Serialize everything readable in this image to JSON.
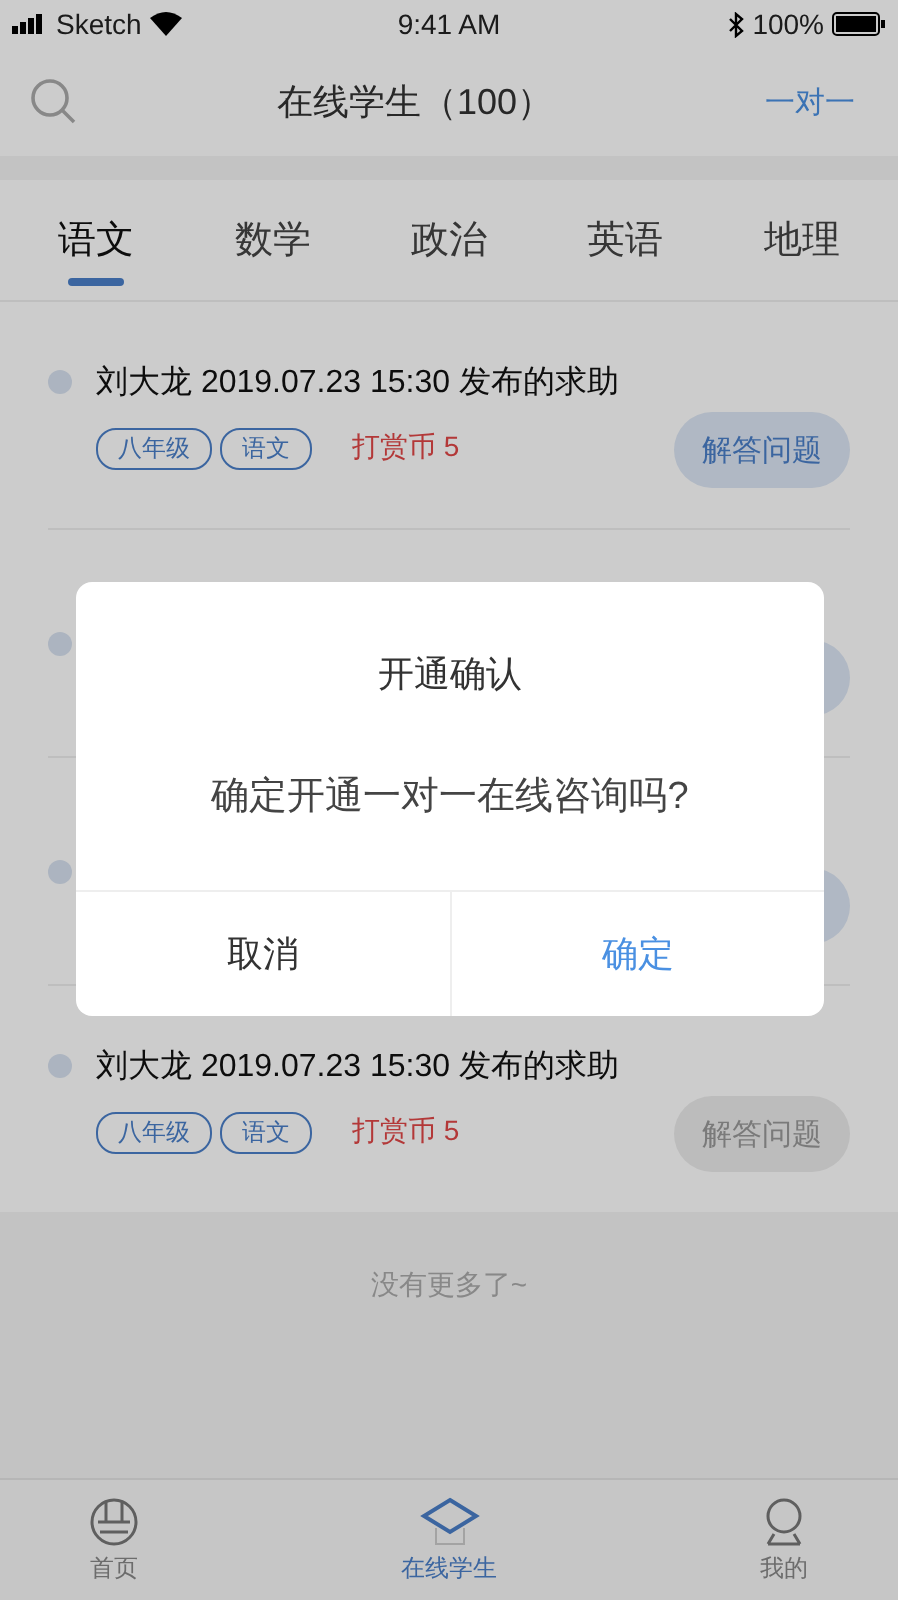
{
  "status_bar": {
    "carrier": "Sketch",
    "time": "9:41 AM",
    "battery": "100%"
  },
  "nav": {
    "title": "在线学生（100）",
    "action": "一对一"
  },
  "tabs": [
    {
      "label": "语文",
      "selected": true
    },
    {
      "label": "数学",
      "selected": false
    },
    {
      "label": "政治",
      "selected": false
    },
    {
      "label": "英语",
      "selected": false
    },
    {
      "label": "地理",
      "selected": false
    }
  ],
  "posts": [
    {
      "kind": "full",
      "title": "刘大龙 2019.07.23 15:30 发布的求助",
      "tags": [
        "八年级",
        "语文"
      ],
      "reward": "打赏币 5",
      "button": "解答问题",
      "disabled": false
    },
    {
      "kind": "covered",
      "disabled": false
    },
    {
      "kind": "covered",
      "disabled": false
    },
    {
      "kind": "full",
      "title": "刘大龙 2019.07.23 15:30 发布的求助",
      "tags": [
        "八年级",
        "语文"
      ],
      "reward": "打赏币 5",
      "button": "解答问题",
      "disabled": true
    }
  ],
  "list_end": "没有更多了~",
  "bottom_tabs": [
    {
      "label": "首页",
      "selected": false
    },
    {
      "label": "在线学生",
      "selected": true
    },
    {
      "label": "我的",
      "selected": false
    }
  ],
  "dialog": {
    "title": "开通确认",
    "message": "确定开通一对一在线咨询吗?",
    "buttons": [
      {
        "label": "取消",
        "primary": false
      },
      {
        "label": "确定",
        "primary": true
      }
    ]
  }
}
